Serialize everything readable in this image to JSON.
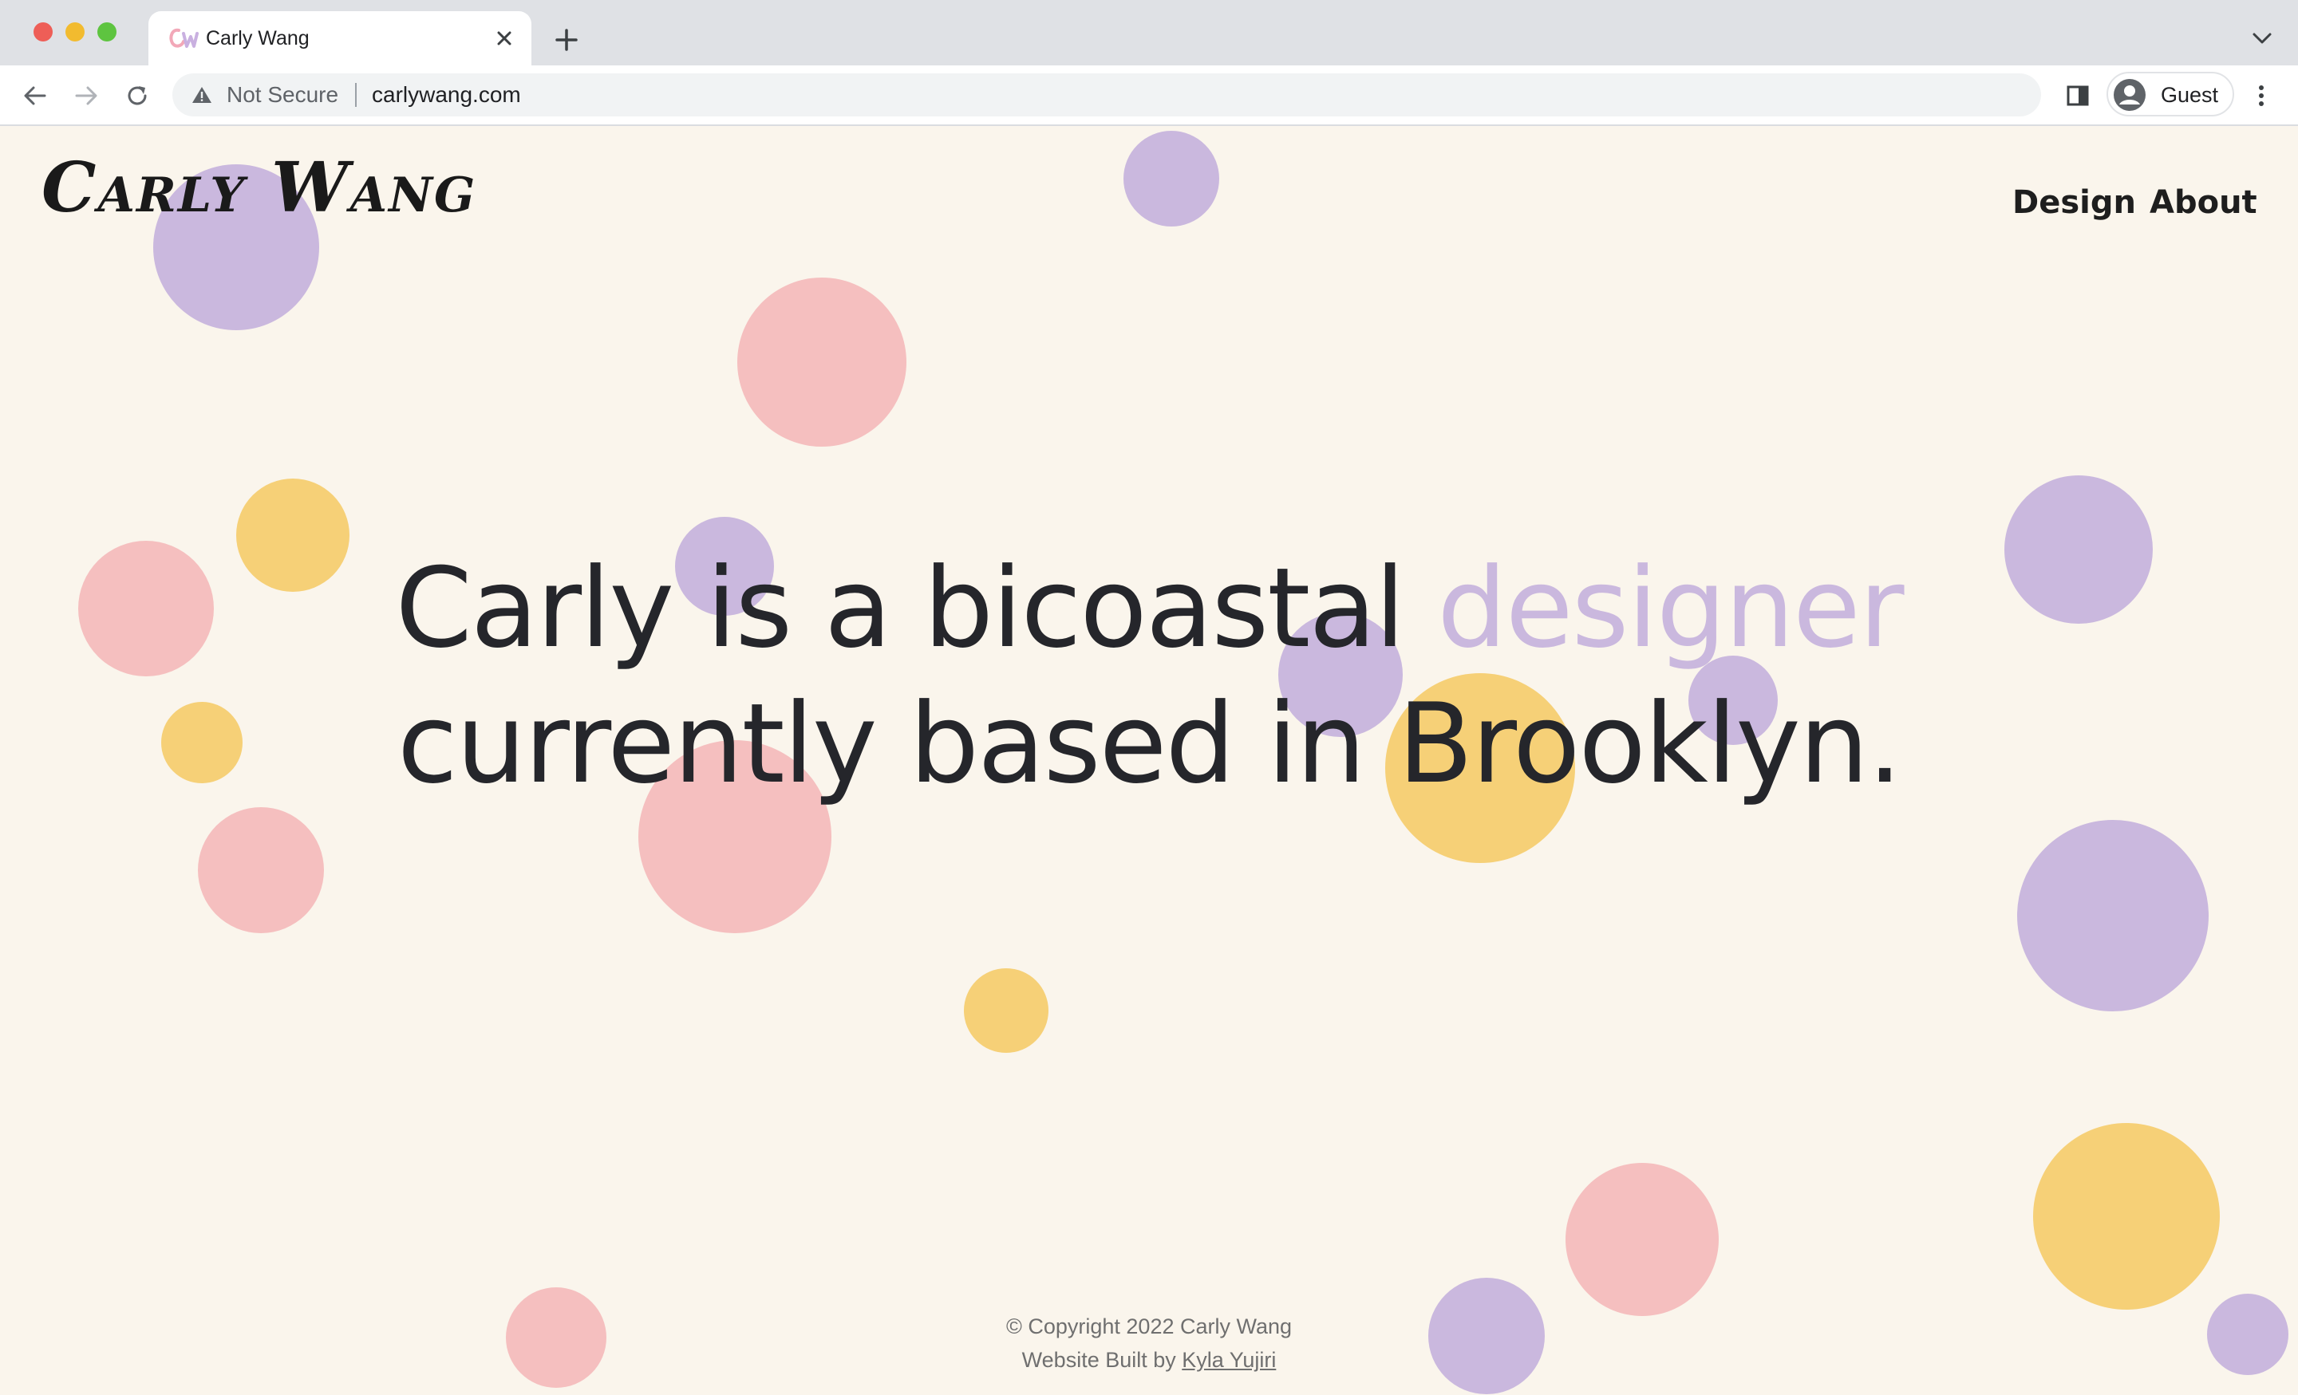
{
  "browser": {
    "tab_title": "Carly Wang",
    "security_label": "Not Secure",
    "url": "carlywang.com",
    "profile_label": "Guest"
  },
  "site": {
    "logo": "Carly Wang",
    "nav": {
      "design": "Design",
      "about": "About"
    },
    "hero": {
      "before": "Carly is a bicoastal ",
      "accent": "designer",
      "after": " currently based in Brooklyn."
    },
    "footer": {
      "copyright": "© Copyright 2022 Carly Wang",
      "built_by_prefix": "Website Built by ",
      "built_by_link": "Kyla Yujiri"
    }
  },
  "colors": {
    "background": "#faf5ec",
    "purple": "#cab8de",
    "pink": "#f5bfbf",
    "yellow": "#f6d077",
    "text": "#25262b"
  }
}
